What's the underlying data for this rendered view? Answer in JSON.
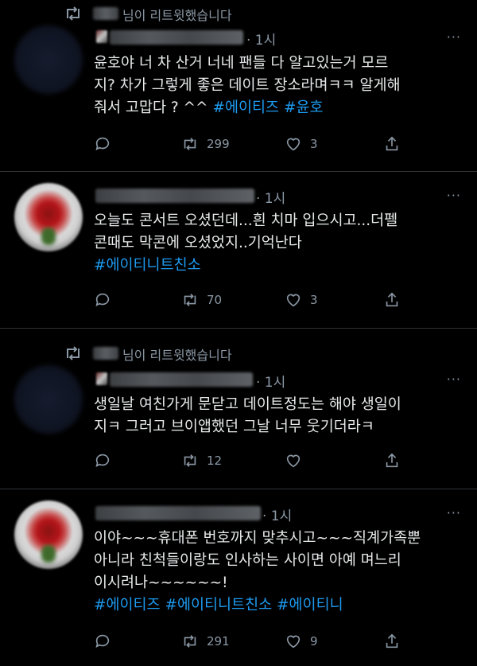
{
  "tweets": [
    {
      "retweet_text": "님이 리트윗했습니다",
      "time": "· 1시",
      "more_label": "···",
      "lines": [
        [
          {
            "t": "윤호야 너 차 산거 너네 팬들 다 알고있는거 모르"
          }
        ],
        [
          {
            "t": "지? 차가 그렇게 좋은 데이트 장소라며ㅋㅋ 알게해"
          }
        ],
        [
          {
            "t": "줘서 고맙다 ? ^^ "
          },
          {
            "t": "#에이티즈",
            "tag": true
          },
          {
            "t": " "
          },
          {
            "t": "#윤호",
            "tag": true
          }
        ]
      ],
      "retweets": "299",
      "likes": "3"
    },
    {
      "time": "· 1시",
      "more_label": "···",
      "lines": [
        [
          {
            "t": "오늘도 콘서트 오셨던데...흰 치마 입으시고...더펠"
          }
        ],
        [
          {
            "t": "콘때도 막콘에 오셨었지..기억난다"
          }
        ],
        [
          {
            "t": "#에이티니트친소",
            "tag": true
          }
        ]
      ],
      "retweets": "70",
      "likes": "3"
    },
    {
      "retweet_text": "님이 리트윗했습니다",
      "time": "· 1시",
      "more_label": "···",
      "lines": [
        [
          {
            "t": "생일날 여친가게 문닫고 데이트정도는 해야 생일이"
          }
        ],
        [
          {
            "t": "지ㅋ 그러고 브이앱했던 그날 너무 웃기더라ㅋ"
          }
        ]
      ],
      "retweets": "12",
      "likes": ""
    },
    {
      "time": "· 1시",
      "more_label": "···",
      "lines": [
        [
          {
            "t": "이야~~~휴대폰 번호까지 맞추시고~~~직계가족뿐"
          }
        ],
        [
          {
            "t": "아니라 친척들이랑도 인사하는 사이면 아예 며느리"
          }
        ],
        [
          {
            "t": "이시려나~~~~~~!"
          }
        ],
        [
          {
            "t": "#에이티즈",
            "tag": true
          },
          {
            "t": " "
          },
          {
            "t": "#에이티니트친소",
            "tag": true
          },
          {
            "t": " "
          },
          {
            "t": "#에이티니",
            "tag": true
          }
        ]
      ],
      "retweets": "291",
      "likes": "9"
    }
  ],
  "colors": {
    "background": "#000000",
    "text": "#e7e9ea",
    "muted": "#8b98a5",
    "hashtag": "#1d9bf0",
    "divider": "#2f3336"
  },
  "icons": {
    "retweet_banner": "retweet-icon",
    "reply": "reply-icon",
    "retweet": "retweet-icon",
    "like": "heart-icon",
    "share": "share-icon",
    "more": "more-icon"
  }
}
